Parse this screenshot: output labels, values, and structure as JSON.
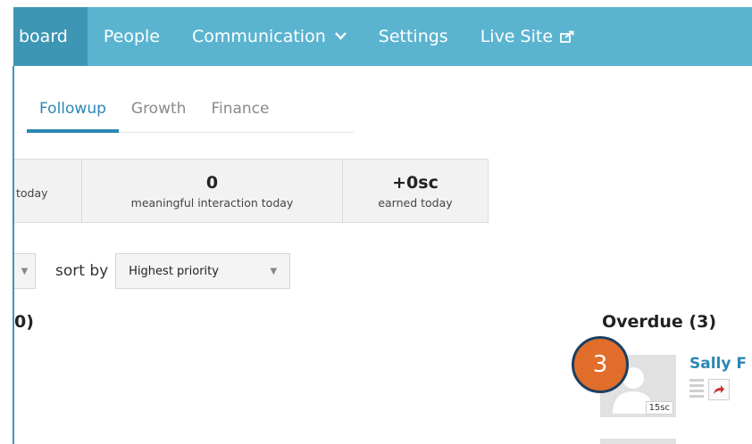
{
  "nav": {
    "items": [
      {
        "label": "board"
      },
      {
        "label": "People"
      },
      {
        "label": "Communication"
      },
      {
        "label": "Settings"
      },
      {
        "label": "Live Site"
      }
    ]
  },
  "tabs": [
    {
      "label": "Followup"
    },
    {
      "label": "Growth"
    },
    {
      "label": "Finance"
    }
  ],
  "stats": [
    {
      "value": "",
      "label": "today"
    },
    {
      "value": "0",
      "label": "meaningful interaction today"
    },
    {
      "value": "+0sc",
      "label": "earned today"
    }
  ],
  "sort": {
    "label": "sort by",
    "selected": "Highest priority"
  },
  "sections": {
    "left_heading": "0)",
    "right_heading": "Overdue (3)"
  },
  "overdue_item": {
    "name": "Sally F",
    "badge": "15sc",
    "marker": "3"
  },
  "colors": {
    "nav_bg": "#5ab4d0",
    "nav_active": "#3d97b4",
    "accent": "#2b87b5",
    "marker": "#e06d2a"
  },
  "icons": [
    "chevron-down-icon",
    "external-link-icon",
    "avatar-placeholder-icon",
    "share-icon",
    "menu-lines-icon"
  ]
}
